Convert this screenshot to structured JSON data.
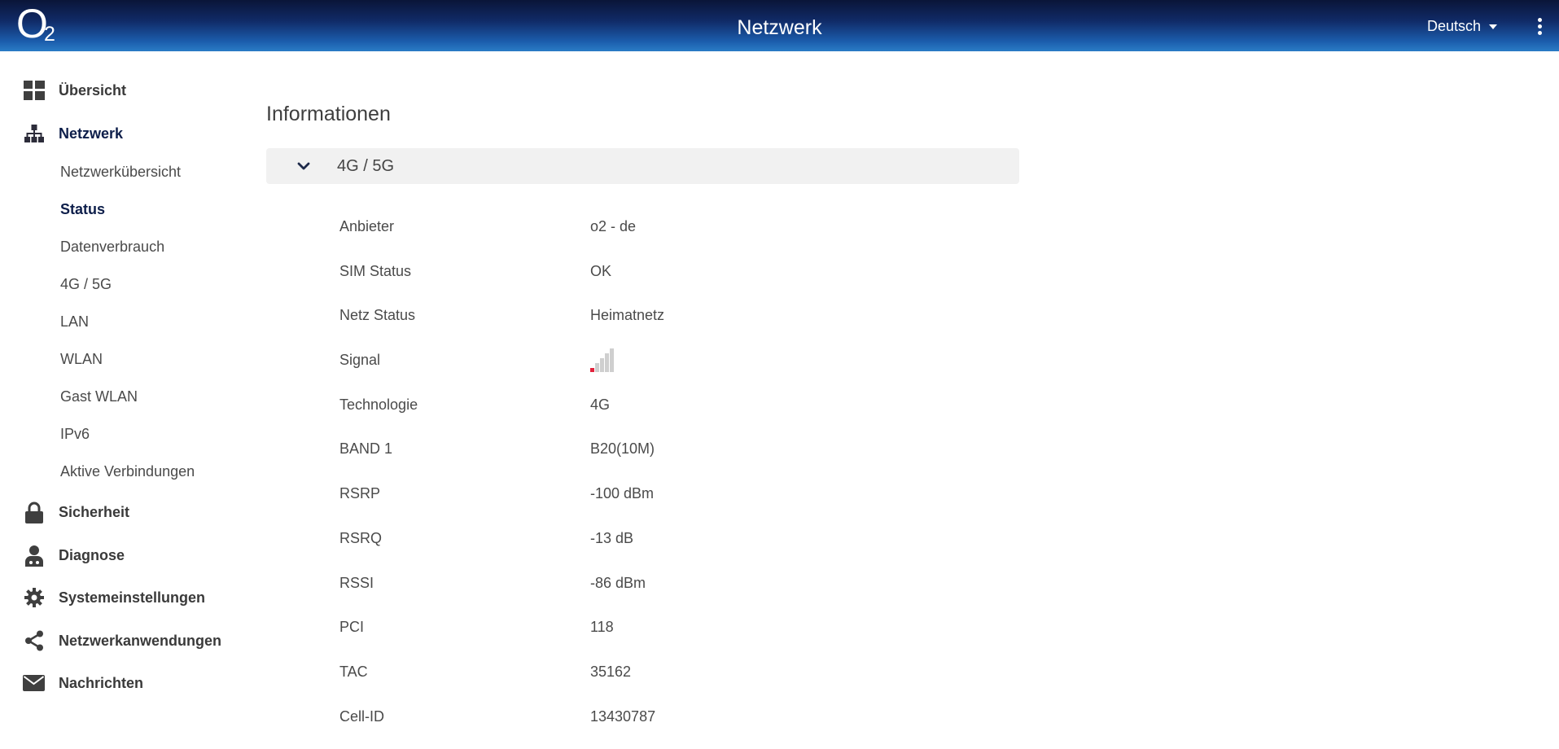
{
  "header": {
    "logo": {
      "letter": "O",
      "subscript": "2"
    },
    "title": "Netzwerk",
    "language": "Deutsch",
    "menu_icon": "kebab-menu-icon"
  },
  "sidebar": {
    "items": [
      {
        "label": "Übersicht",
        "icon": "dashboard-grid-icon"
      },
      {
        "label": "Netzwerk",
        "icon": "network-hierarchy-icon",
        "active": true,
        "children": [
          {
            "label": "Netzwerkübersicht"
          },
          {
            "label": "Status",
            "active": true
          },
          {
            "label": "Datenverbrauch"
          },
          {
            "label": "4G / 5G"
          },
          {
            "label": "LAN"
          },
          {
            "label": "WLAN"
          },
          {
            "label": "Gast WLAN"
          },
          {
            "label": "IPv6"
          },
          {
            "label": "Aktive Verbindungen"
          }
        ]
      },
      {
        "label": "Sicherheit",
        "icon": "lock-icon"
      },
      {
        "label": "Diagnose",
        "icon": "doctor-icon"
      },
      {
        "label": "Systemeinstellungen",
        "icon": "gear-icon"
      },
      {
        "label": "Netzwerkanwendungen",
        "icon": "share-icon"
      },
      {
        "label": "Nachrichten",
        "icon": "envelope-icon"
      }
    ]
  },
  "main": {
    "section_title": "Informationen",
    "accordion": {
      "label": "4G / 5G",
      "expanded": true,
      "icon": "chevron-down-icon"
    },
    "rows": [
      {
        "key": "Anbieter",
        "value": "o2 - de"
      },
      {
        "key": "SIM Status",
        "value": "OK"
      },
      {
        "key": "Netz Status",
        "value": "Heimatnetz"
      },
      {
        "key": "Signal",
        "value": "",
        "signal_bars_active": 1,
        "signal_bars_total": 5
      },
      {
        "key": "Technologie",
        "value": "4G"
      },
      {
        "key": "BAND 1",
        "value": "B20(10M)"
      },
      {
        "key": "RSRP",
        "value": "-100 dBm"
      },
      {
        "key": "RSRQ",
        "value": "-13 dB"
      },
      {
        "key": "RSSI",
        "value": "-86 dBm"
      },
      {
        "key": "PCI",
        "value": "118"
      },
      {
        "key": "TAC",
        "value": "35162"
      },
      {
        "key": "Cell-ID",
        "value": "13430787"
      }
    ]
  },
  "colors": {
    "header_dark": "#0a1538",
    "header_light": "#2a7cc6",
    "active_nav": "#0d1e4a",
    "signal_active": "#e2233c",
    "signal_inactive": "#cfcfcf",
    "accordion_bg": "#f1f1f1"
  }
}
